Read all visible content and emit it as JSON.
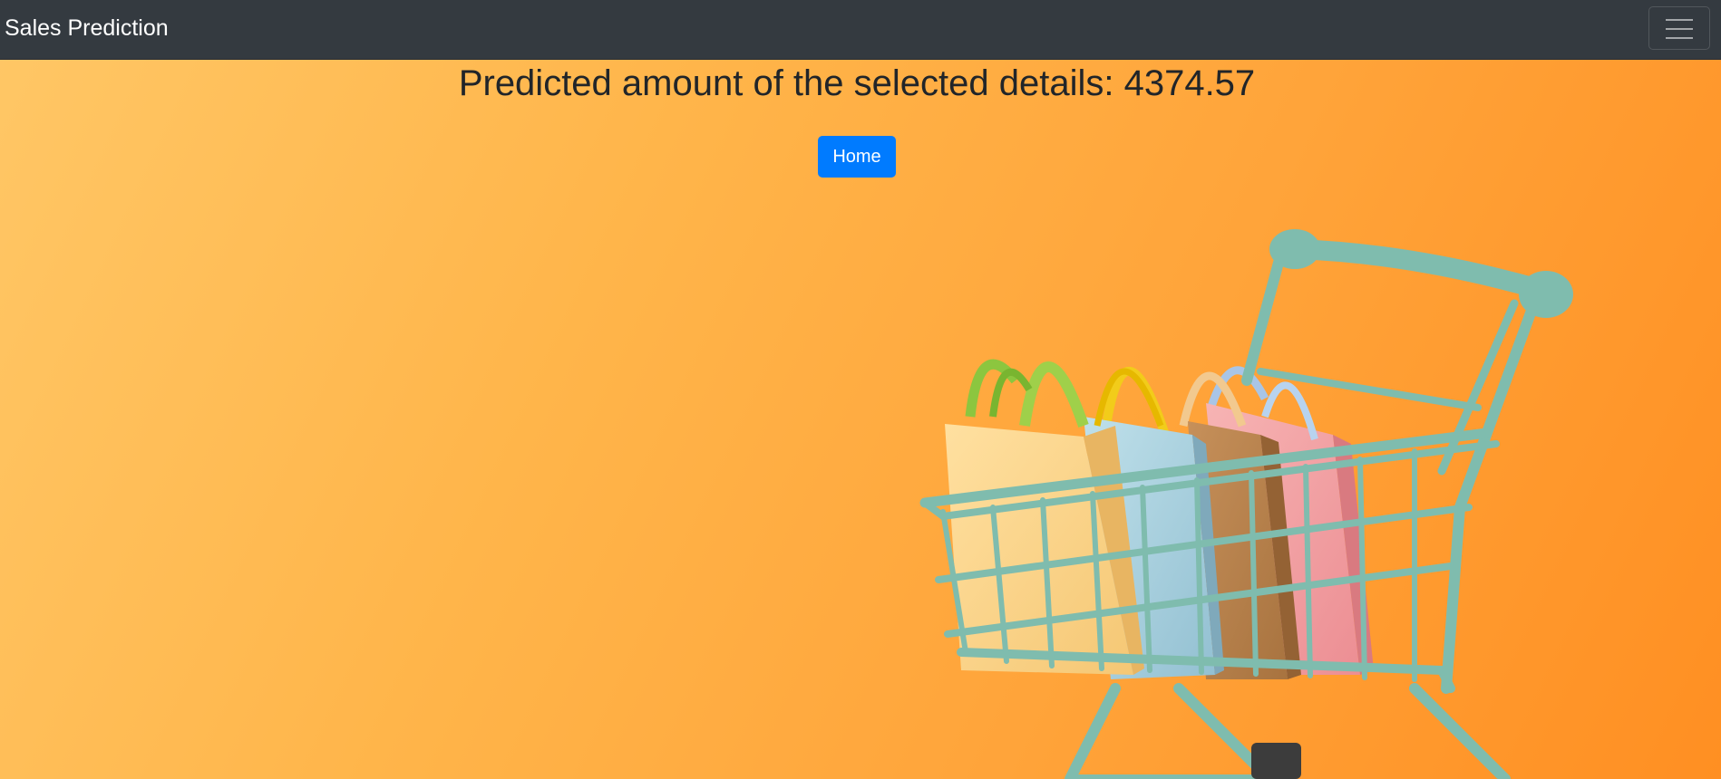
{
  "navbar": {
    "brand": "Sales Prediction",
    "toggler_icon": "hamburger-menu-icon"
  },
  "main": {
    "headline": "Predicted amount of the selected details: 4374.57",
    "home_button": "Home"
  },
  "colors": {
    "navbar_bg": "#343a40",
    "accent": "#007bff",
    "background": "#ffa43a",
    "cart": "#7fbcae"
  },
  "image": {
    "subject": "shopping-cart-with-bags-illustration"
  }
}
